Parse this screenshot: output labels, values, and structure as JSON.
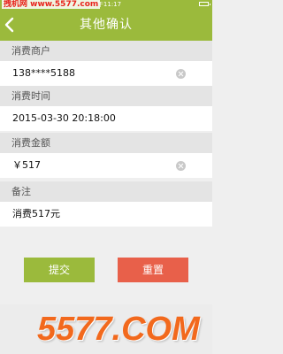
{
  "status": {
    "time": "下午11:17"
  },
  "watermark_top": "拽机网 www.5577.com",
  "header": {
    "title": "其他确认"
  },
  "fields": [
    {
      "label": "消费商户",
      "value": "138****5188"
    },
    {
      "label": "消费时间",
      "value": "2015-03-30 20:18:00"
    },
    {
      "label": "消费金额",
      "value": "￥517"
    },
    {
      "label": "备注",
      "value": "消费517元"
    }
  ],
  "buttons": {
    "submit": "提交",
    "reset": "重置"
  },
  "watermark_logo": "5577.COM",
  "icons": [
    "back-arrow-icon",
    "clear-icon",
    "battery-icon"
  ]
}
